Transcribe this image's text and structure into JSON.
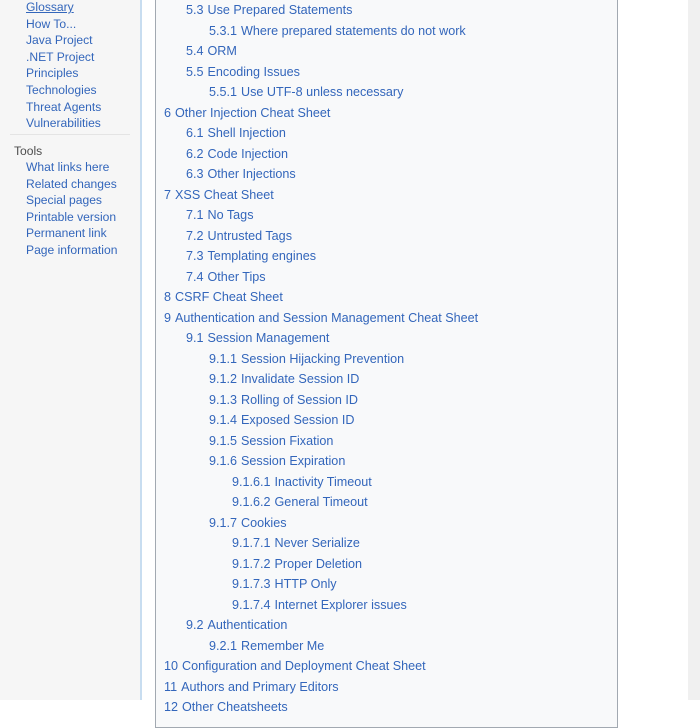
{
  "sidebar": {
    "navigation": {
      "items": [
        {
          "label": "Glossary"
        },
        {
          "label": "How To..."
        },
        {
          "label": "Java Project"
        },
        {
          "label": ".NET Project"
        },
        {
          "label": "Principles"
        },
        {
          "label": "Technologies"
        },
        {
          "label": "Threat Agents"
        },
        {
          "label": "Vulnerabilities"
        }
      ]
    },
    "tools": {
      "heading": "Tools",
      "items": [
        {
          "label": "What links here"
        },
        {
          "label": "Related changes"
        },
        {
          "label": "Special pages"
        },
        {
          "label": "Printable version"
        },
        {
          "label": "Permanent link"
        },
        {
          "label": "Page information"
        }
      ]
    }
  },
  "toc": {
    "entries": [
      {
        "number": "5.3",
        "text": "Use Prepared Statements",
        "level": 2
      },
      {
        "number": "5.3.1",
        "text": "Where prepared statements do not work",
        "level": 3
      },
      {
        "number": "5.4",
        "text": "ORM",
        "level": 2
      },
      {
        "number": "5.5",
        "text": "Encoding Issues",
        "level": 2
      },
      {
        "number": "5.5.1",
        "text": "Use UTF-8 unless necessary",
        "level": 3
      },
      {
        "number": "6",
        "text": "Other Injection Cheat Sheet",
        "level": 1
      },
      {
        "number": "6.1",
        "text": "Shell Injection",
        "level": 2
      },
      {
        "number": "6.2",
        "text": "Code Injection",
        "level": 2
      },
      {
        "number": "6.3",
        "text": "Other Injections",
        "level": 2
      },
      {
        "number": "7",
        "text": "XSS Cheat Sheet",
        "level": 1
      },
      {
        "number": "7.1",
        "text": "No Tags",
        "level": 2
      },
      {
        "number": "7.2",
        "text": "Untrusted Tags",
        "level": 2
      },
      {
        "number": "7.3",
        "text": "Templating engines",
        "level": 2
      },
      {
        "number": "7.4",
        "text": "Other Tips",
        "level": 2
      },
      {
        "number": "8",
        "text": "CSRF Cheat Sheet",
        "level": 1
      },
      {
        "number": "9",
        "text": "Authentication and Session Management Cheat Sheet",
        "level": 1
      },
      {
        "number": "9.1",
        "text": "Session Management",
        "level": 2
      },
      {
        "number": "9.1.1",
        "text": "Session Hijacking Prevention",
        "level": 3
      },
      {
        "number": "9.1.2",
        "text": "Invalidate Session ID",
        "level": 3
      },
      {
        "number": "9.1.3",
        "text": "Rolling of Session ID",
        "level": 3
      },
      {
        "number": "9.1.4",
        "text": "Exposed Session ID",
        "level": 3
      },
      {
        "number": "9.1.5",
        "text": "Session Fixation",
        "level": 3
      },
      {
        "number": "9.1.6",
        "text": "Session Expiration",
        "level": 3
      },
      {
        "number": "9.1.6.1",
        "text": "Inactivity Timeout",
        "level": 4
      },
      {
        "number": "9.1.6.2",
        "text": "General Timeout",
        "level": 4
      },
      {
        "number": "9.1.7",
        "text": "Cookies",
        "level": 3
      },
      {
        "number": "9.1.7.1",
        "text": "Never Serialize",
        "level": 4
      },
      {
        "number": "9.1.7.2",
        "text": "Proper Deletion",
        "level": 4
      },
      {
        "number": "9.1.7.3",
        "text": "HTTP Only",
        "level": 4
      },
      {
        "number": "9.1.7.4",
        "text": "Internet Explorer issues",
        "level": 4
      },
      {
        "number": "9.2",
        "text": "Authentication",
        "level": 2
      },
      {
        "number": "9.2.1",
        "text": "Remember Me",
        "level": 3
      },
      {
        "number": "10",
        "text": "Configuration and Deployment Cheat Sheet",
        "level": 1
      },
      {
        "number": "11",
        "text": "Authors and Primary Editors",
        "level": 1
      },
      {
        "number": "12",
        "text": "Other Cheatsheets",
        "level": 1
      }
    ]
  },
  "colors": {
    "link": "#3366bb",
    "toc_background": "#f8f9fa",
    "toc_border": "#a2a9b1",
    "sidebar_background": "#f6f6f6",
    "sidebar_rule": "#c8ddf0",
    "heading_text": "#4d4d4d",
    "page_gutter": "#f0f0f0"
  }
}
